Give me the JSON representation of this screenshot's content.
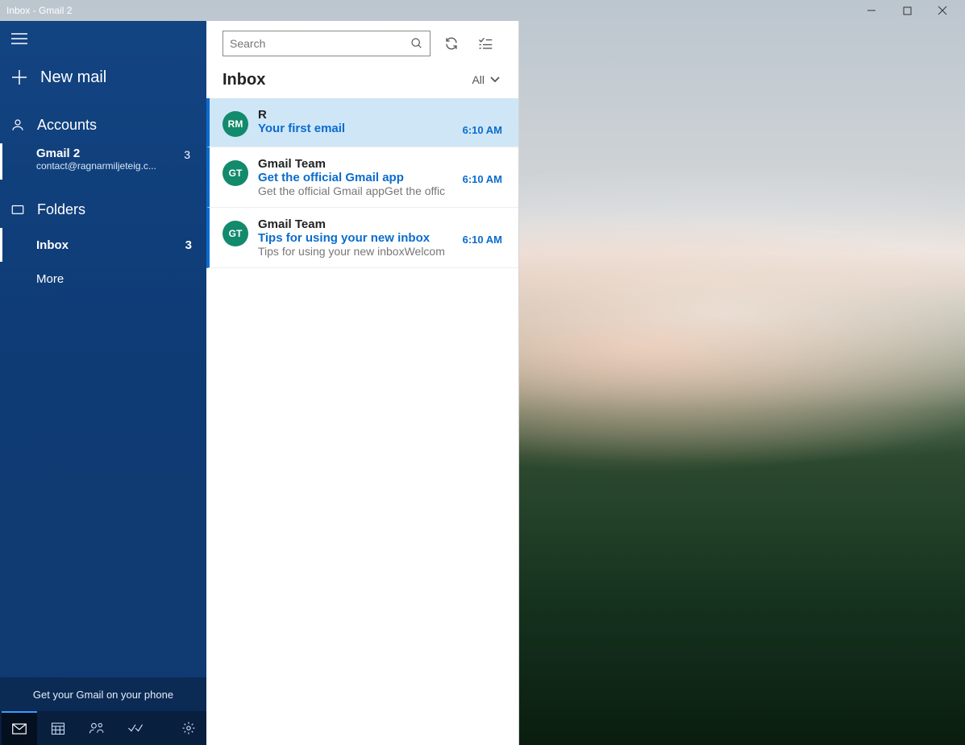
{
  "window": {
    "title": "Inbox - Gmail 2"
  },
  "sidebar": {
    "new_mail_label": "New mail",
    "accounts_label": "Accounts",
    "account": {
      "name": "Gmail 2",
      "email": "contact@ragnarmiljeteig.c...",
      "badge": "3"
    },
    "folders_label": "Folders",
    "folders": [
      {
        "label": "Inbox",
        "badge": "3"
      },
      {
        "label": "More"
      }
    ],
    "promo": "Get your Gmail on your phone"
  },
  "search": {
    "placeholder": "Search"
  },
  "list": {
    "header": "Inbox",
    "filter_label": "All",
    "emails": [
      {
        "avatar": "RM",
        "sender": "R",
        "subject": "Your first email",
        "preview": "",
        "time": "6:10 AM"
      },
      {
        "avatar": "GT",
        "sender": "Gmail Team",
        "subject": "Get the official Gmail app",
        "preview": "Get the official Gmail appGet the offic",
        "time": "6:10 AM"
      },
      {
        "avatar": "GT",
        "sender": "Gmail Team",
        "subject": "Tips for using your new inbox",
        "preview": "Tips for using your new inboxWelcom",
        "time": "6:10 AM"
      }
    ]
  }
}
